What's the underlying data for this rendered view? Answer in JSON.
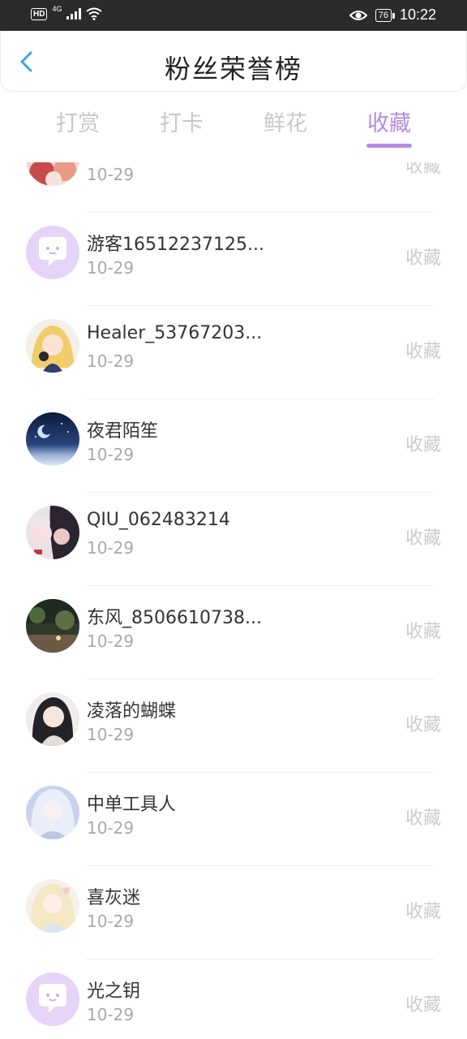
{
  "status_bar": {
    "network_badge": "HD",
    "network_type": "4G",
    "battery": "76",
    "time": "10:22"
  },
  "header": {
    "title": "粉丝荣誉榜",
    "back_icon": "chevron-left-icon"
  },
  "tabs": [
    {
      "label": "打赏",
      "active": false
    },
    {
      "label": "打卡",
      "active": false
    },
    {
      "label": "鲜花",
      "active": false
    },
    {
      "label": "收藏",
      "active": true
    }
  ],
  "colors": {
    "accent": "#b58be4",
    "tab_inactive": "#c8c8c8",
    "action_text": "#cccccc",
    "date_text": "#a8a8a8"
  },
  "list": [
    {
      "name": "",
      "date": "10-29",
      "action": "收藏",
      "avatar": "anime-red-hair"
    },
    {
      "name": "游客16512237125...",
      "date": "10-29",
      "action": "收藏",
      "avatar": "default-chat-bubble"
    },
    {
      "name": "Healer_53767203...",
      "date": "10-29",
      "action": "收藏",
      "avatar": "anime-blonde-girl"
    },
    {
      "name": "夜君陌笙",
      "date": "10-29",
      "action": "收藏",
      "avatar": "night-sky"
    },
    {
      "name": "QIU_062483214",
      "date": "10-29",
      "action": "收藏",
      "avatar": "anime-couple"
    },
    {
      "name": "东风_8506610738...",
      "date": "10-29",
      "action": "收藏",
      "avatar": "street-night"
    },
    {
      "name": "凌落的蝴蝶",
      "date": "10-29",
      "action": "收藏",
      "avatar": "anime-black-hair"
    },
    {
      "name": "中单工具人",
      "date": "10-29",
      "action": "收藏",
      "avatar": "anime-white-hair"
    },
    {
      "name": "喜灰迷",
      "date": "10-29",
      "action": "收藏",
      "avatar": "anime-pastel"
    },
    {
      "name": "光之钥",
      "date": "10-29",
      "action": "收藏",
      "avatar": "default-chat-bubble"
    }
  ]
}
